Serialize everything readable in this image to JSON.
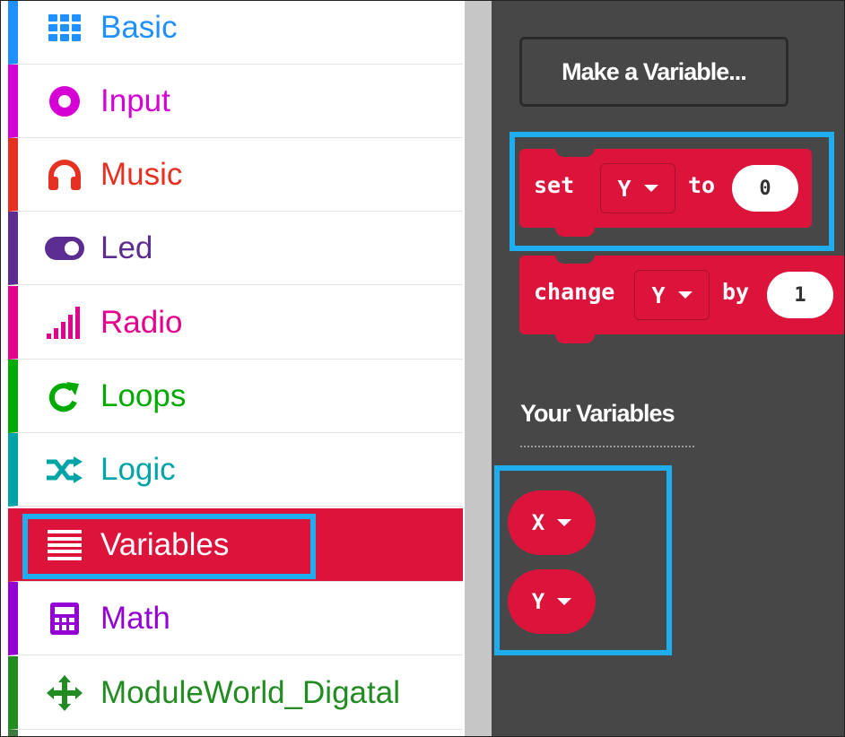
{
  "toolbox": {
    "categories": [
      {
        "label": "Basic",
        "color": "#1e90ff",
        "icon": "grid-icon"
      },
      {
        "label": "Input",
        "color": "#d400d4",
        "icon": "target-icon"
      },
      {
        "label": "Music",
        "color": "#e63022",
        "icon": "headphones-icon"
      },
      {
        "label": "Led",
        "color": "#5c2d91",
        "icon": "toggle-icon"
      },
      {
        "label": "Radio",
        "color": "#e3008c",
        "icon": "signal-bars-icon"
      },
      {
        "label": "Loops",
        "color": "#00aa00",
        "icon": "loop-arrow-icon"
      },
      {
        "label": "Logic",
        "color": "#00a4a6",
        "icon": "shuffle-icon"
      },
      {
        "label": "Variables",
        "color": "#dc143c",
        "icon": "list-lines-icon",
        "selected": true
      },
      {
        "label": "Math",
        "color": "#9400d3",
        "icon": "calculator-icon"
      },
      {
        "label": "ModuleWorld_Digatal",
        "color": "#228b22",
        "icon": "move-arrows-icon"
      }
    ]
  },
  "flyout": {
    "make_variable_label": "Make a Variable...",
    "set_block": {
      "kw_set": "set",
      "var": "Y",
      "kw_to": "to",
      "value": "0"
    },
    "change_block": {
      "kw_change": "change",
      "var": "Y",
      "kw_by": "by",
      "value": "1"
    },
    "your_variables_label": "Your Variables",
    "variables": [
      "X",
      "Y"
    ]
  },
  "colors": {
    "flyout_bg": "#484748",
    "variables_block": "#dc143c",
    "highlight": "#1eaef0",
    "scrollbar": "#c6c6c6"
  }
}
